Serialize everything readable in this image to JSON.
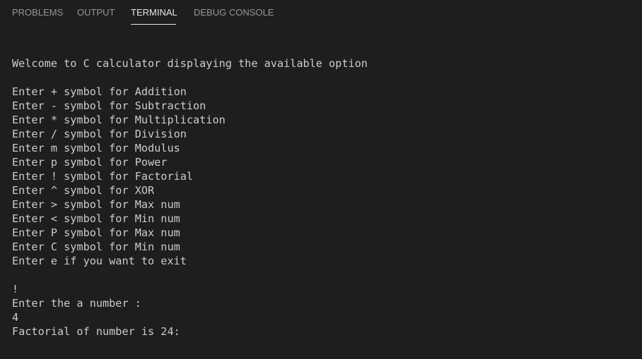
{
  "panel": {
    "tabs": [
      {
        "label": "PROBLEMS"
      },
      {
        "label": "OUTPUT"
      },
      {
        "label": "TERMINAL"
      },
      {
        "label": "DEBUG CONSOLE"
      }
    ],
    "active_tab": "TERMINAL"
  },
  "terminal": {
    "lines": [
      "Welcome to C calculator displaying the available option",
      "",
      "Enter + symbol for Addition",
      "Enter - symbol for Subtraction",
      "Enter * symbol for Multiplication",
      "Enter / symbol for Division",
      "Enter m symbol for Modulus",
      "Enter p symbol for Power",
      "Enter ! symbol for Factorial",
      "Enter ^ symbol for XOR",
      "Enter > symbol for Max num",
      "Enter < symbol for Min num",
      "Enter P symbol for Max num",
      "Enter C symbol for Min num",
      "Enter e if you want to exit",
      "",
      "!",
      "Enter the a number :",
      "4",
      "Factorial of number is 24:"
    ]
  },
  "colors": {
    "background": "#1e1e1e",
    "terminal_text": "#cccccc",
    "tab_inactive": "#969696",
    "tab_active": "#e7e7e7"
  }
}
